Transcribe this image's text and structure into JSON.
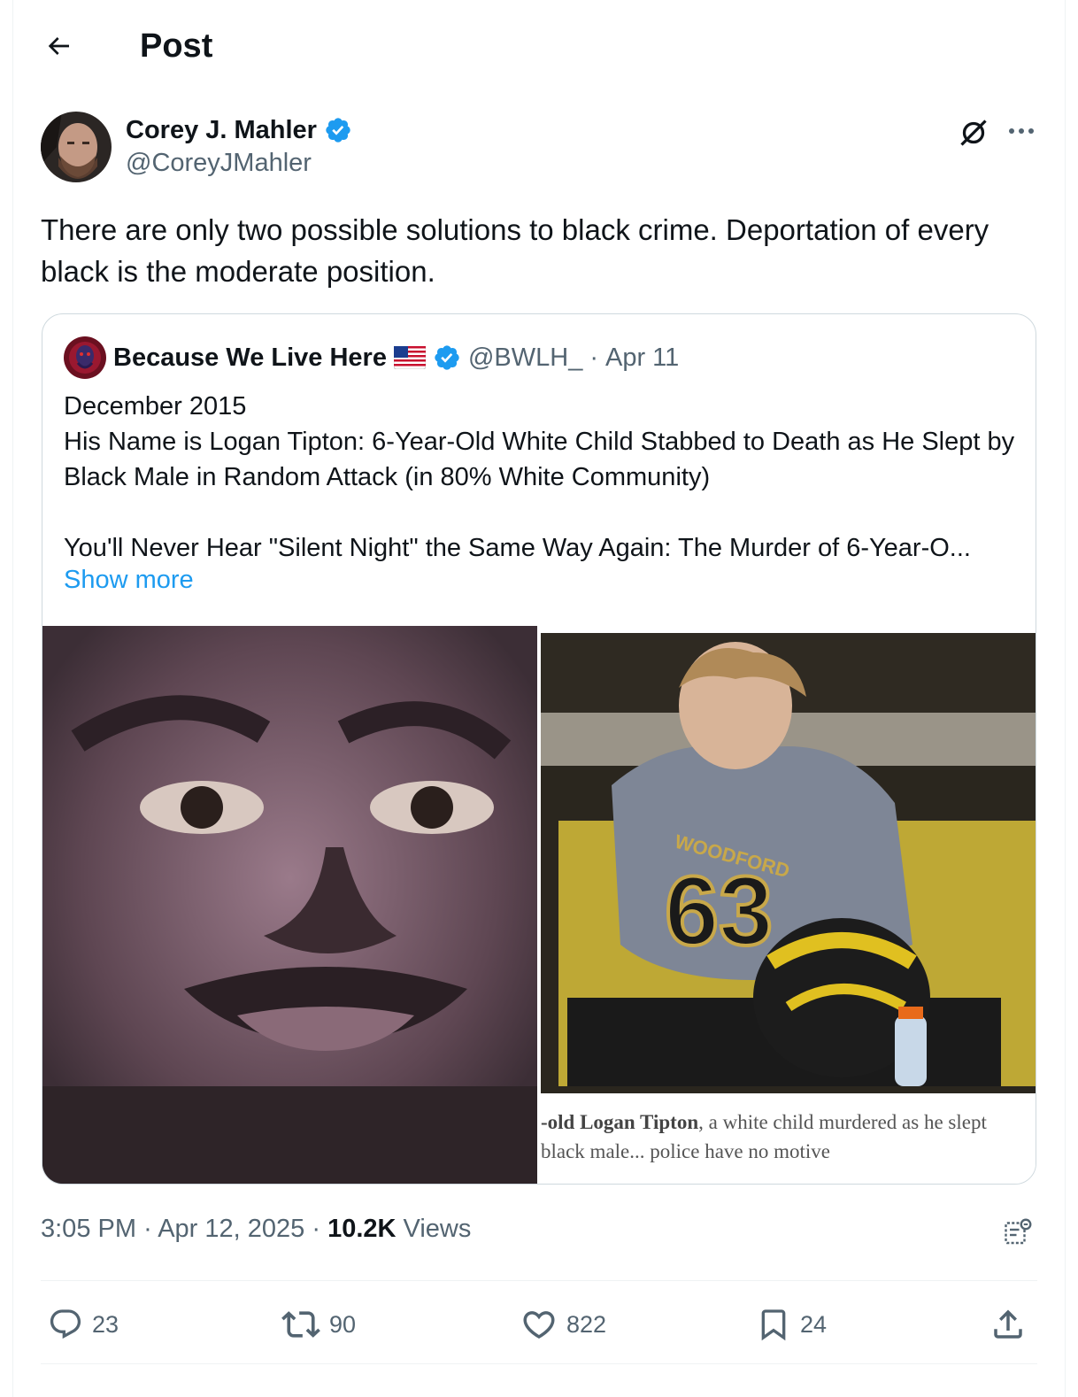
{
  "header": {
    "title": "Post"
  },
  "post": {
    "author_name": "Corey J. Mahler",
    "author_handle": "@CoreyJMahler",
    "text": "There are only two possible solutions to black crime. Deportation of every black is the moderate position.",
    "quote": {
      "author_name": "Because We Live Here",
      "flag": "🇺🇸",
      "author_handle": "@BWLH_",
      "separator": "·",
      "date": "Apr 11",
      "body": "December 2015\nHis Name is Logan Tipton: 6-Year-Old White Child Stabbed to Death as He Slept by Black Male in Random Attack (in 80% White Community)\n\nYou'll Never Hear \"Silent Night\" the Same Way Again: The Murder of 6-Year-O...",
      "show_more": "Show more",
      "caption_bold": "-old Logan Tipton",
      "caption_rest": ", a white child murdered as he slept",
      "caption_line2": "black male... police have no motive"
    },
    "meta": {
      "time": "3:05 PM",
      "separator": "·",
      "date": "Apr 12, 2025",
      "views_count": "10.2K",
      "views_label": "Views"
    },
    "actions": {
      "replies": "23",
      "reposts": "90",
      "likes": "822",
      "bookmarks": "24"
    }
  },
  "colors": {
    "accent": "#1d9bf0",
    "secondary_text": "#536471",
    "primary_text": "#0f1419",
    "border": "#cfd9de"
  },
  "icons": [
    "back-arrow-icon",
    "verified-badge-icon",
    "grok-icon",
    "more-icon",
    "analytics-icon",
    "reply-icon",
    "repost-icon",
    "like-icon",
    "bookmark-icon",
    "share-icon"
  ]
}
